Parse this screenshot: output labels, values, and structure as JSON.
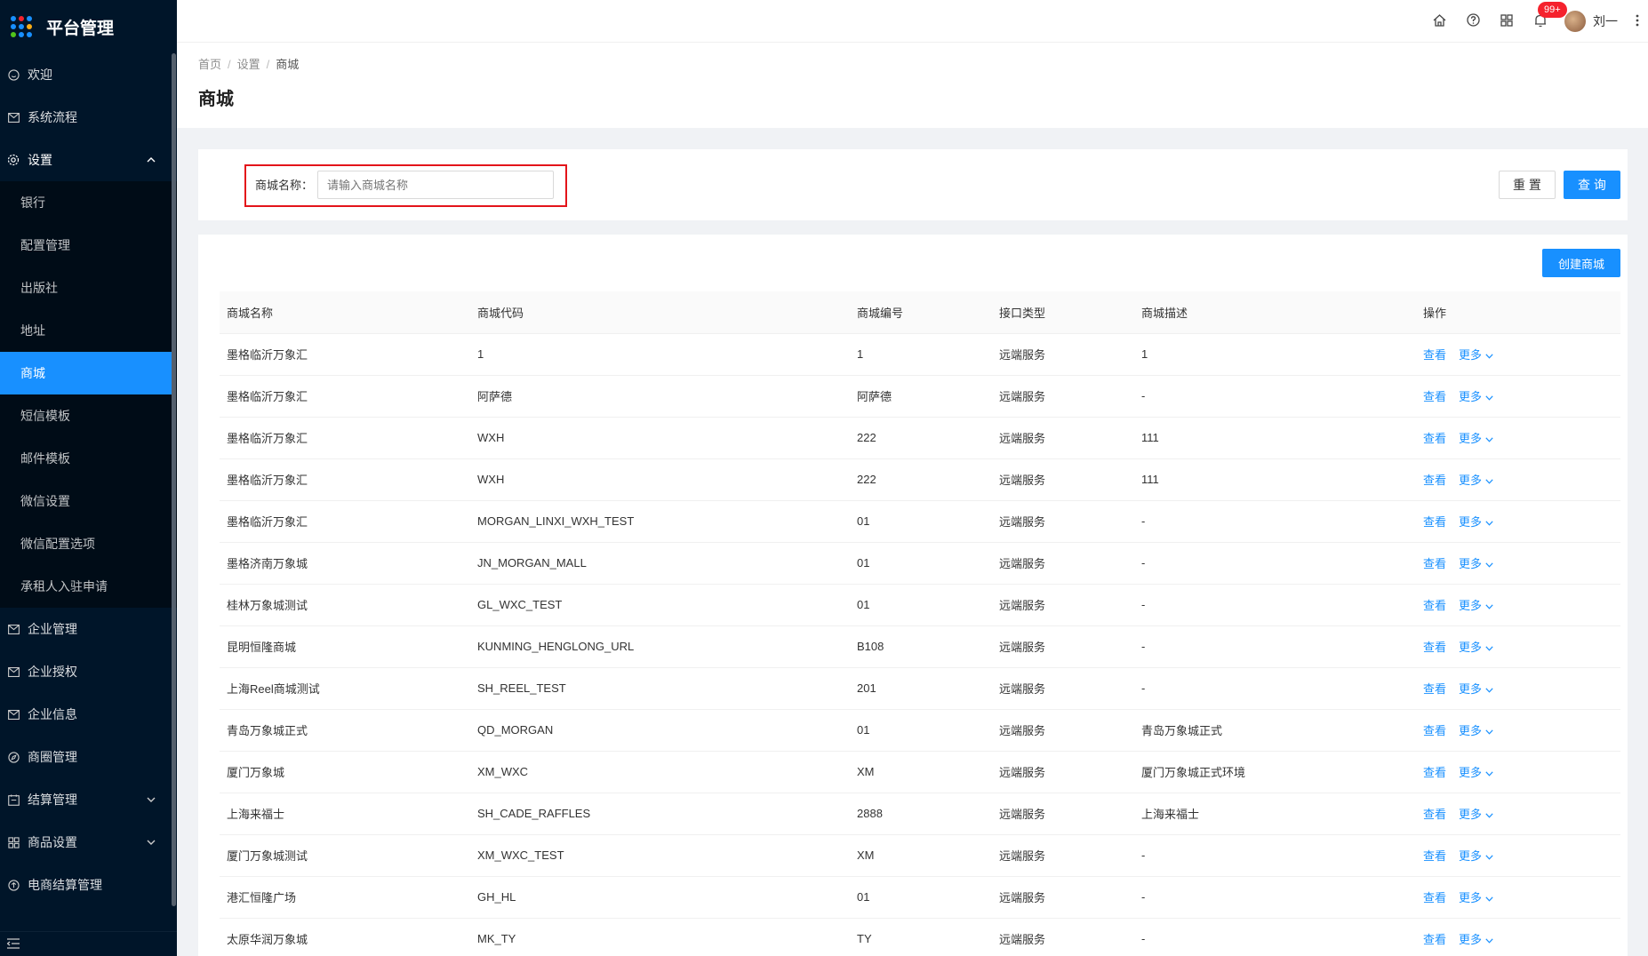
{
  "app": {
    "title": "平台管理"
  },
  "sidebar": {
    "top_items": [
      {
        "label": "欢迎",
        "icon": "smile-icon"
      },
      {
        "label": "系统流程",
        "icon": "mail-icon"
      }
    ],
    "settings": {
      "label": "设置",
      "icon": "gear-icon",
      "expanded": true
    },
    "sub_items": [
      {
        "label": "银行"
      },
      {
        "label": "配置管理"
      },
      {
        "label": "出版社"
      },
      {
        "label": "地址"
      },
      {
        "label": "商城",
        "active": true
      },
      {
        "label": "短信模板"
      },
      {
        "label": "邮件模板"
      },
      {
        "label": "微信设置"
      },
      {
        "label": "微信配置选项"
      },
      {
        "label": "承租人入驻申请"
      }
    ],
    "bottom_items": [
      {
        "label": "企业管理",
        "icon": "mail-icon"
      },
      {
        "label": "企业授权",
        "icon": "mail-icon"
      },
      {
        "label": "企业信息",
        "icon": "mail-icon"
      },
      {
        "label": "商圈管理",
        "icon": "compass-icon"
      },
      {
        "label": "结算管理",
        "icon": "calendar-icon",
        "has_arrow": true
      },
      {
        "label": "商品设置",
        "icon": "appstore-icon",
        "has_arrow": true
      },
      {
        "label": "电商结算管理",
        "icon": "sync-icon"
      }
    ]
  },
  "header": {
    "notification_badge": "99+",
    "user_name": "刘一"
  },
  "breadcrumb": [
    "首页",
    "设置",
    "商城"
  ],
  "page_title": "商城",
  "search": {
    "label": "商城名称：",
    "placeholder": "请输入商城名称",
    "reset_label": "重 置",
    "query_label": "查 询"
  },
  "create_label": "创建商城",
  "table": {
    "columns": [
      "商城名称",
      "商城代码",
      "商城编号",
      "接口类型",
      "商城描述",
      "操作"
    ],
    "action_view": "查看",
    "action_more": "更多",
    "rows": [
      [
        "墨格临沂万象汇",
        "1",
        "1",
        "远端服务",
        "1"
      ],
      [
        "墨格临沂万象汇",
        "阿萨德",
        "阿萨德",
        "远端服务",
        "-"
      ],
      [
        "墨格临沂万象汇",
        "WXH",
        "222",
        "远端服务",
        "111"
      ],
      [
        "墨格临沂万象汇",
        "WXH",
        "222",
        "远端服务",
        "111"
      ],
      [
        "墨格临沂万象汇",
        "MORGAN_LINXI_WXH_TEST",
        "01",
        "远端服务",
        "-"
      ],
      [
        "墨格济南万象城",
        "JN_MORGAN_MALL",
        "01",
        "远端服务",
        "-"
      ],
      [
        "桂林万象城测试",
        "GL_WXC_TEST",
        "01",
        "远端服务",
        "-"
      ],
      [
        "昆明恒隆商城",
        "KUNMING_HENGLONG_URL",
        "B108",
        "远端服务",
        "-"
      ],
      [
        "上海Reel商城测试",
        "SH_REEL_TEST",
        "201",
        "远端服务",
        "-"
      ],
      [
        "青岛万象城正式",
        "QD_MORGAN",
        "01",
        "远端服务",
        "青岛万象城正式"
      ],
      [
        "厦门万象城",
        "XM_WXC",
        "XM",
        "远端服务",
        "厦门万象城正式环境"
      ],
      [
        "上海来福士",
        "SH_CADE_RAFFLES",
        "2888",
        "远端服务",
        "上海来福士"
      ],
      [
        "厦门万象城测试",
        "XM_WXC_TEST",
        "XM",
        "远端服务",
        "-"
      ],
      [
        "港汇恒隆广场",
        "GH_HL",
        "01",
        "远端服务",
        "-"
      ],
      [
        "太原华润万象城",
        "MK_TY",
        "TY",
        "远端服务",
        "-"
      ]
    ]
  },
  "colors": {
    "primary": "#1890ff",
    "sidebar_bg": "#001529",
    "highlight": "#e3141a"
  }
}
